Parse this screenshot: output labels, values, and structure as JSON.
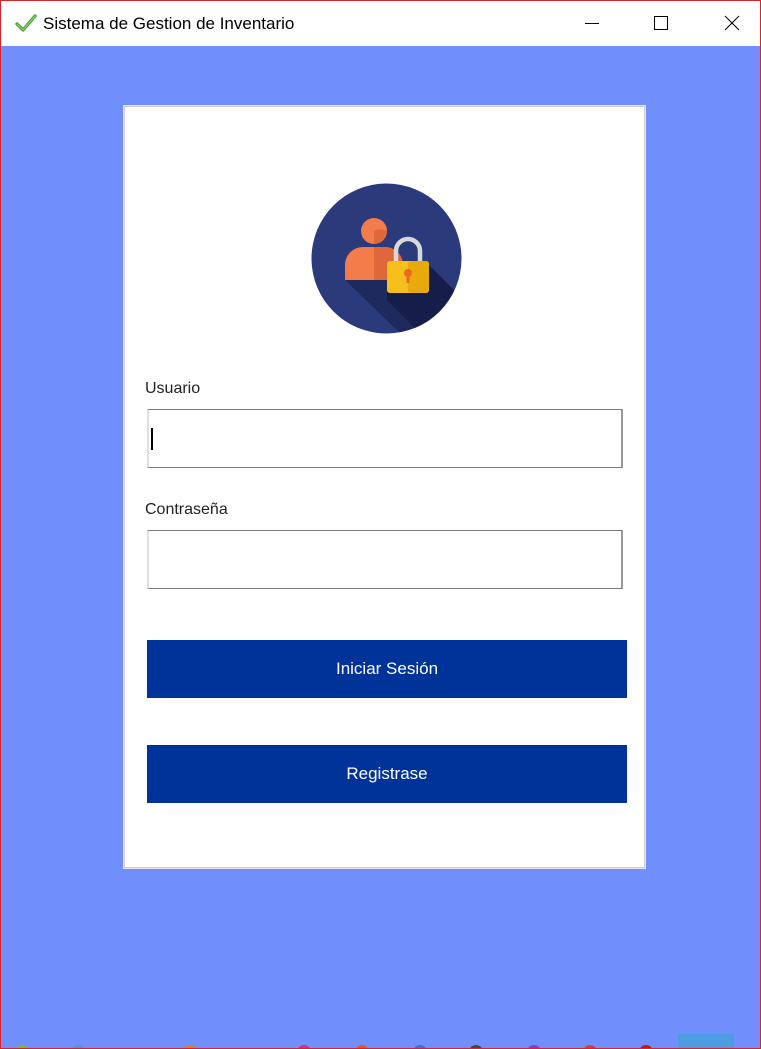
{
  "window": {
    "title": "Sistema de Gestion de Inventario",
    "app_icon": "green-checkmark-icon",
    "controls": [
      "minimize-icon",
      "maximize-icon",
      "close-icon"
    ]
  },
  "colors": {
    "background": "#708ffd",
    "card": "#ffffff",
    "button": "#003399",
    "button_text": "#ffffff",
    "avatar_circle": "#2b3a7a",
    "avatar_person": "#f47c4a",
    "avatar_lock": "#f5c01c"
  },
  "login": {
    "avatar_icon": "user-lock-icon",
    "username_label": "Usuario",
    "username_value": "",
    "password_label": "Contraseña",
    "password_value": "",
    "login_button": "Iniciar Sesión",
    "register_button": "Registrase"
  }
}
